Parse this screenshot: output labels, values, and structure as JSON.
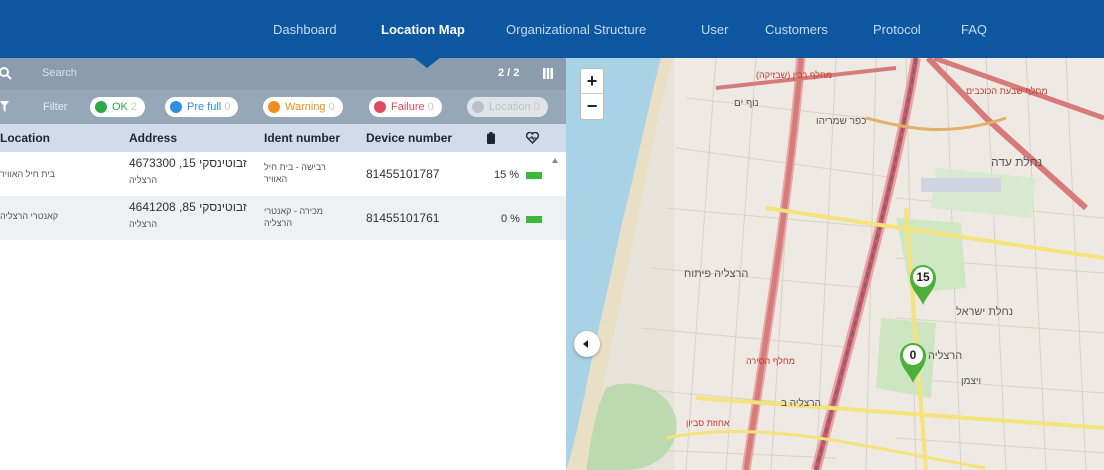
{
  "nav": {
    "items": [
      {
        "label": "Dashboard",
        "active": false
      },
      {
        "label": "Location Map",
        "active": true
      },
      {
        "label": "Organizational Structure",
        "active": false
      },
      {
        "label": "User",
        "active": false
      },
      {
        "label": "Customers",
        "active": false
      },
      {
        "label": "Protocol",
        "active": false
      },
      {
        "label": "FAQ",
        "active": false
      }
    ]
  },
  "search": {
    "placeholder": "Search",
    "count": "2 / 2"
  },
  "filter": {
    "label": "Filter",
    "chips": [
      {
        "label": "OK",
        "count": "2",
        "color": "#2ea84a"
      },
      {
        "label": "Pre full",
        "count": "0",
        "color": "#2f8fe0"
      },
      {
        "label": "Warning",
        "count": "0",
        "color": "#f28c1c"
      },
      {
        "label": "Failure",
        "count": "0",
        "color": "#e04a5f"
      },
      {
        "label": "Location",
        "count": "0",
        "color": "#b9c0c8"
      }
    ]
  },
  "table": {
    "headers": {
      "location": "Location",
      "address": "Address",
      "ident": "Ident number",
      "device": "Device number"
    },
    "rows": [
      {
        "location": "בית חיל האוויר",
        "address_line1": "זבוטינסקי 15, 4673300",
        "address_line2": "הרצליה",
        "ident_line1": "רבישה - בית חיל",
        "ident_line2": "האוויר",
        "device": "81455101787",
        "battery": "15 %",
        "battery_level": 0.15
      },
      {
        "location": "קאנטרי הרצליה",
        "address_line1": "זבוטינסקי 85, 4641208",
        "address_line2": "הרצליה",
        "ident_line1": "מכירה - קאנטרי",
        "ident_line2": "הרצליה",
        "device": "81455101761",
        "battery": "0 %",
        "battery_level": 0.0
      }
    ]
  },
  "map": {
    "zoom_in": "+",
    "zoom_out": "−",
    "markers": [
      {
        "label": "15",
        "color": "#4caf3a"
      },
      {
        "label": "0",
        "color": "#4caf3a"
      }
    ],
    "place_labels": [
      "מחלף שבעת הכוכבים",
      "מחלף רבין (שבזיקה)",
      "נוף ים",
      "כפר שמריהו",
      "נחלת עדה",
      "הרצליה פיתוח",
      "נחלת ישראל",
      "הרצליה",
      "ויצמן",
      "מחלף הסירה",
      "אחוזת סביון",
      "הרצליה ב"
    ]
  },
  "colors": {
    "nav_bg": "#0d57a1",
    "search_bg": "#8a9cae",
    "filter_bg": "#96a7b8",
    "header_bg": "#d0dcea",
    "battery": "#3cb83c"
  }
}
